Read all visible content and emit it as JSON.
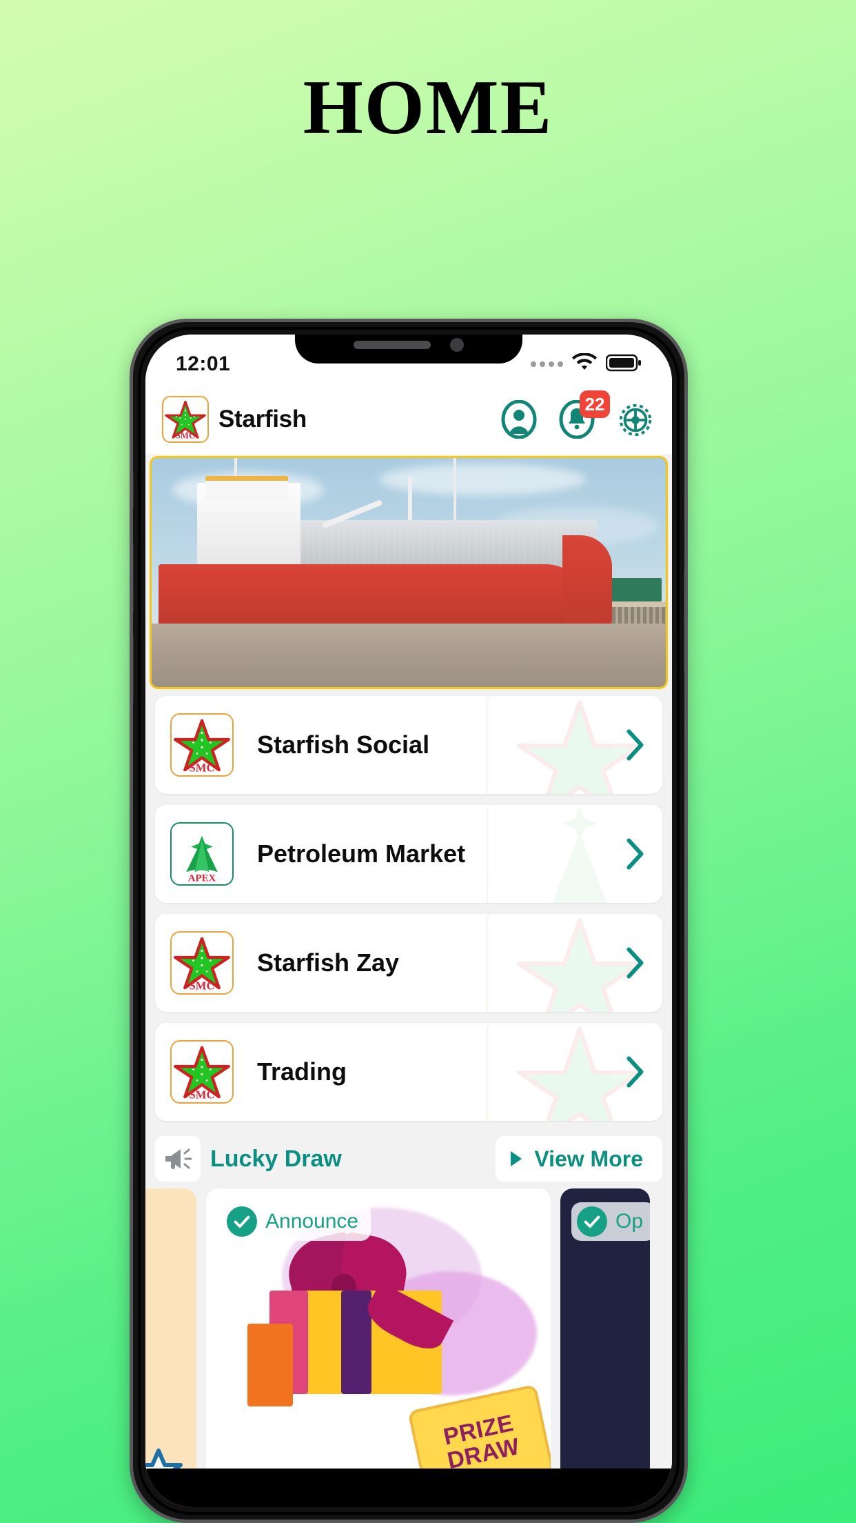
{
  "page": {
    "title": "HOME"
  },
  "status_bar": {
    "time": "12:01",
    "wifi_icon": "wifi-icon",
    "battery_icon": "battery-full-icon",
    "signal_icon": "signal-dots-icon"
  },
  "app_header": {
    "brand_name": "Starfish",
    "brand_logo_icon": "starfish-smc-logo",
    "brand_logo_text": "SMC",
    "actions": [
      {
        "name": "profile-icon",
        "label": "Profile"
      },
      {
        "name": "notification-bell-icon",
        "label": "Notifications",
        "badge": "22"
      },
      {
        "name": "settings-gear-icon",
        "label": "Settings"
      }
    ]
  },
  "hero": {
    "alt": "Red oil tanker ship docked at jetty",
    "border_color": "#f5c518"
  },
  "menu": {
    "items": [
      {
        "label": "Starfish Social",
        "logo": "starfish-smc-logo",
        "logo_text": "SMC",
        "logo_kind": "smc",
        "chevron": "chevron-right-icon"
      },
      {
        "label": "Petroleum Market",
        "logo": "apex-logo",
        "logo_text": "APEX",
        "logo_kind": "apex",
        "chevron": "chevron-right-icon"
      },
      {
        "label": "Starfish Zay",
        "logo": "starfish-smc-logo",
        "logo_text": "SMC",
        "logo_kind": "smc",
        "chevron": "chevron-right-icon"
      },
      {
        "label": "Trading",
        "logo": "starfish-smc-logo",
        "logo_text": "SMC",
        "logo_kind": "smc",
        "chevron": "chevron-right-icon"
      }
    ]
  },
  "lucky_draw": {
    "icon": "megaphone-icon",
    "title": "Lucky Draw",
    "view_more_label": "View More",
    "view_more_icon": "play-triangle-icon"
  },
  "promos": [
    {
      "kind": "side-left",
      "badge_label": "",
      "art": "star-burst-card"
    },
    {
      "kind": "main",
      "badge_label": "Announce",
      "art": "gift-prize-draw",
      "ticket_line1": "PRIZE",
      "ticket_line2": "DRAW"
    },
    {
      "kind": "side-right",
      "badge_label": "Op",
      "art": "dark-card"
    }
  ],
  "colors": {
    "background_top": "#d4fcae",
    "background_bottom": "#3bec79",
    "accent_teal": "#0b8f82",
    "badge_red": "#f04438",
    "brand_gold": "#e8a33a",
    "hero_border": "#f5c518"
  }
}
